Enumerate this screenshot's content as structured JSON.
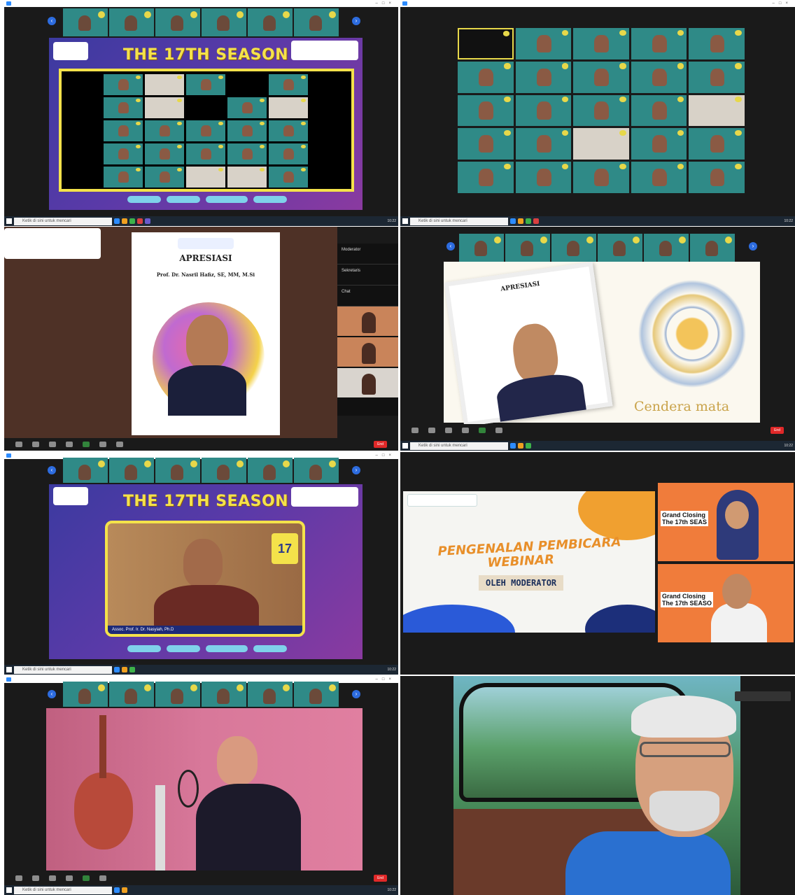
{
  "panel1": {
    "banner_title": "THE 17TH SEASON",
    "chips": [
      "",
      "",
      "",
      ""
    ]
  },
  "panel3": {
    "apresiasi": "APRESIASI",
    "speaker_name": "Prof. Dr. Nasril Hafiz, SE, MM, M.Si",
    "side_chat": "Chat",
    "side_items": [
      "Moderator",
      "Sekretaris"
    ]
  },
  "panel4": {
    "apresiasi": "APRESIASI",
    "cendera": "Cendera mata"
  },
  "panel5": {
    "banner_title": "THE 17TH SEASON",
    "badge": "17",
    "speaker_caption": "Assoc. Prof. Ir. Dr. Nasyiah, Ph.D"
  },
  "panel6": {
    "title_line1": "PENGENALAN PEMBICARA",
    "title_line2": "WEBINAR",
    "subtitle": "OLEH MODERATOR",
    "cam1_label_l1": "Grand Closing",
    "cam1_label_l2": "The 17th SEAS",
    "cam2_label_l1": "Grand Closing",
    "cam2_label_l2": "The 17th SEASO"
  },
  "taskbar": {
    "search_placeholder": "Ketik di sini untuk mencari",
    "time": "10:22"
  },
  "colors": {
    "zoom_blue": "#2d8cff",
    "banner_yellow": "#f4e24a",
    "end_red": "#e02828"
  }
}
